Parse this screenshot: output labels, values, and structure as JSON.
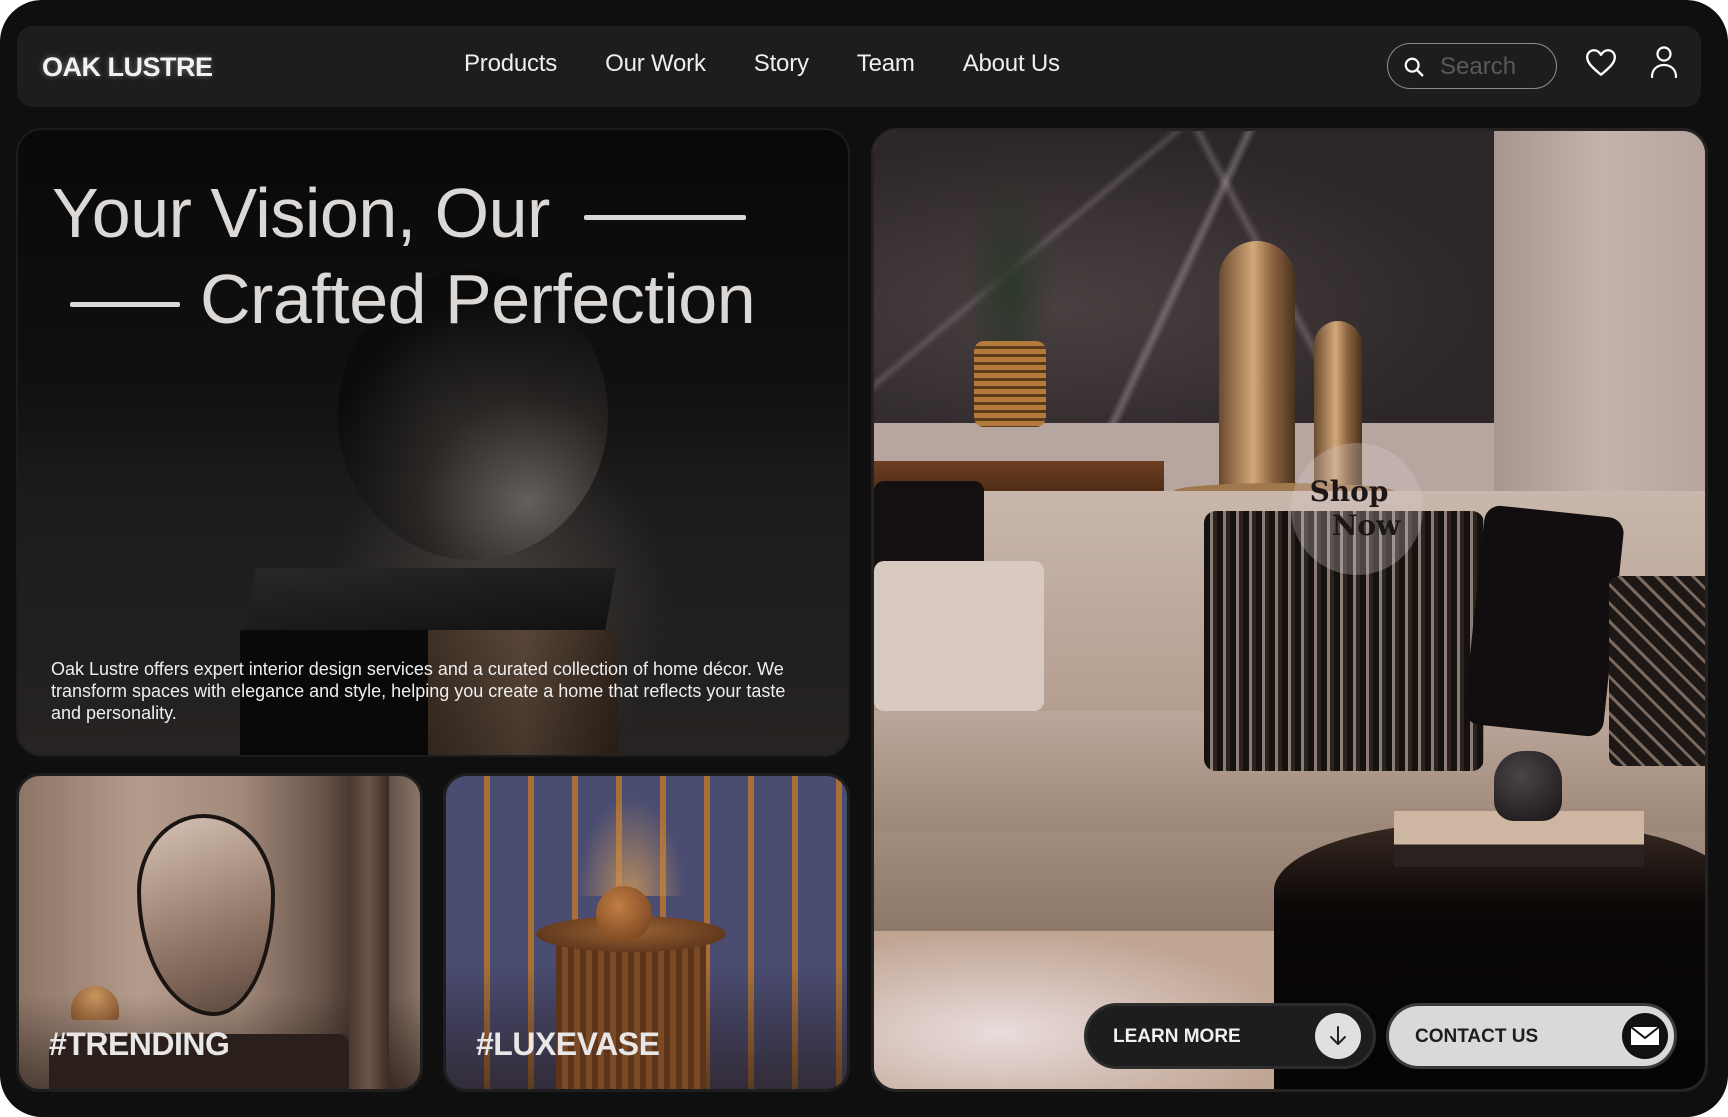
{
  "brand": {
    "name": "OAK LUSTRE"
  },
  "nav": {
    "links": [
      {
        "label": "Products"
      },
      {
        "label": "Our Work"
      },
      {
        "label": "Story"
      },
      {
        "label": "Team"
      },
      {
        "label": "About Us"
      }
    ],
    "search": {
      "placeholder": "Search",
      "value": ""
    },
    "icons": {
      "search": "search-icon",
      "wishlist": "heart-icon",
      "account": "user-icon"
    }
  },
  "hero": {
    "title_line1": "Your Vision, Our",
    "title_line2": "Crafted Perfection",
    "description": "Oak Lustre offers expert interior design services and a curated collection of home décor. We transform spaces with elegance and style, helping you create a home that reflects your taste and personality."
  },
  "tag_cards": [
    {
      "label": "#TRENDING"
    },
    {
      "label": "#LUXEVASE"
    }
  ],
  "showcase": {
    "badge_line1": "Shop",
    "badge_line2": "Now",
    "learn_more": {
      "label": "LEARN MORE",
      "icon": "arrow-down-icon"
    },
    "contact_us": {
      "label": "CONTACT US",
      "icon": "mail-icon"
    }
  },
  "colors": {
    "frame_bg": "#0f0f0f",
    "nav_bg": "#1d1d1d",
    "text_primary": "#eeeeee",
    "hero_title": "#dcd8d6",
    "button_dark": "#1d1d1d",
    "button_light": "#d9d9d9"
  }
}
